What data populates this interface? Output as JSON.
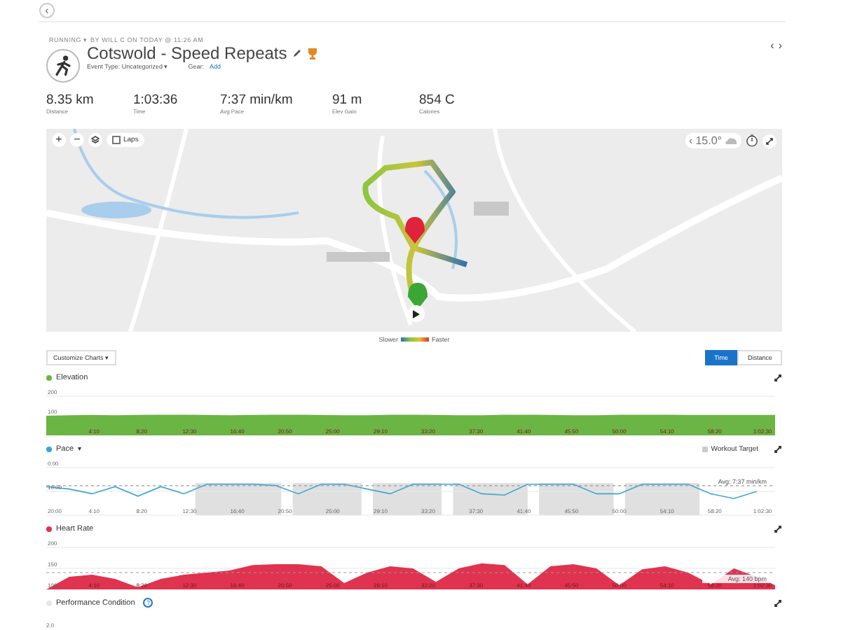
{
  "nav": {
    "back": "‹",
    "prev": "‹",
    "next": "›"
  },
  "activity": {
    "breadcrumb": "RUNNING ▾  BY WILL C ON TODAY @ 11:26 AM",
    "title": "Cotswold - Speed Repeats",
    "event_type": "Event Type: Uncategorized ▾",
    "gear_label": "Gear:",
    "gear_link": "Add"
  },
  "stats": [
    {
      "value": "8.35 km",
      "label": "Distance"
    },
    {
      "value": "1:03:36",
      "label": "Time"
    },
    {
      "value": "7:37 min/km",
      "label": "Avg Pace"
    },
    {
      "value": "91 m",
      "label": "Elev Gain"
    },
    {
      "value": "854 C",
      "label": "Calories"
    }
  ],
  "map": {
    "kind": "picture",
    "zoom_in": "+",
    "zoom_out": "−",
    "laps": {
      "label": "Laps",
      "checked": false
    },
    "weather_prev": "‹",
    "temperature": "15.0°"
  },
  "legend": {
    "slower": "Slower",
    "faster": "Faster"
  },
  "customize": "Customize Charts ▾",
  "view_toggle": [
    {
      "label": "Time",
      "selected": true
    },
    {
      "label": "Distance",
      "selected": false
    }
  ],
  "charts": [
    {
      "color": "#6bb544",
      "chart_data": {
        "type": "area",
        "title": "Elevation",
        "x": [
          0,
          2,
          4,
          6,
          8,
          10,
          12,
          14,
          16,
          18,
          20,
          22,
          24,
          26,
          28,
          30,
          32,
          34,
          36,
          38,
          40,
          42,
          44,
          46,
          48,
          50,
          52,
          54,
          56,
          58,
          60,
          62,
          63.6
        ],
        "xlim": [
          0,
          63.6
        ],
        "ylim": [
          0,
          200
        ],
        "yticks": [
          100,
          200
        ],
        "xticks": [
          {
            "value": 4.17,
            "label": "4:10"
          },
          {
            "value": 8.33,
            "label": "8:20"
          },
          {
            "value": 12.5,
            "label": "12:30"
          },
          {
            "value": 16.67,
            "label": "16:40"
          },
          {
            "value": 20.83,
            "label": "20:50"
          },
          {
            "value": 25,
            "label": "25:00"
          },
          {
            "value": 29.17,
            "label": "29:10"
          },
          {
            "value": 33.33,
            "label": "33:20"
          },
          {
            "value": 37.5,
            "label": "37:30"
          },
          {
            "value": 41.67,
            "label": "41:40"
          },
          {
            "value": 45.83,
            "label": "45:50"
          },
          {
            "value": 50,
            "label": "50:00"
          },
          {
            "value": 54.17,
            "label": "54:10"
          },
          {
            "value": 58.33,
            "label": "58:20"
          },
          {
            "value": 62.5,
            "label": "1:02:30"
          }
        ],
        "series": [
          {
            "color": "#6bb544",
            "values": [
              100,
              103,
              104,
              103,
              104,
              106,
              105,
              104,
              103,
              104,
              106,
              105,
              104,
              103,
              103,
              106,
              105,
              104,
              103,
              103,
              105,
              106,
              104,
              103,
              103,
              105,
              106,
              105,
              104,
              104,
              104,
              104,
              104
            ]
          }
        ]
      }
    },
    {
      "color": "#3aa6d8",
      "menu": "▾",
      "target_legend": "Workout Target",
      "average_label": "Avg: 7:37 min/km",
      "chart_data": {
        "type": "line",
        "title": "Pace",
        "x": [
          0,
          2,
          4,
          6,
          8,
          10,
          12,
          14,
          16,
          18,
          20,
          22,
          24,
          26,
          28,
          30,
          32,
          34,
          36,
          38,
          40,
          42,
          44,
          46,
          48,
          50,
          52,
          54,
          56,
          58,
          60,
          62
        ],
        "xlim": [
          0,
          63.6
        ],
        "ylim": [
          20,
          0
        ],
        "yticks": [
          {
            "value": 0,
            "label": "0:00"
          },
          {
            "value": 10,
            "label": "10:00"
          },
          {
            "value": 20,
            "label": "20:00"
          }
        ],
        "xticks": [
          {
            "value": 4.17,
            "label": "4:10"
          },
          {
            "value": 8.33,
            "label": "8:20"
          },
          {
            "value": 12.5,
            "label": "12:30"
          },
          {
            "value": 16.67,
            "label": "16:40"
          },
          {
            "value": 20.83,
            "label": "20:50"
          },
          {
            "value": 25,
            "label": "25:00"
          },
          {
            "value": 29.17,
            "label": "29:10"
          },
          {
            "value": 33.33,
            "label": "33:20"
          },
          {
            "value": 37.5,
            "label": "37:30"
          },
          {
            "value": 41.67,
            "label": "41:40"
          },
          {
            "value": 45.83,
            "label": "45:50"
          },
          {
            "value": 50,
            "label": "50:00"
          },
          {
            "value": 54.17,
            "label": "54:10"
          },
          {
            "value": 58.33,
            "label": "58:20"
          },
          {
            "value": 62.5,
            "label": "1:02:30"
          }
        ],
        "series": [
          {
            "color": "#3aa6d8",
            "values": [
              8,
              9,
              11,
              8,
              12,
              8,
              11,
              7,
              7,
              7,
              7.5,
              11,
              7,
              7,
              9,
              11,
              7,
              7,
              7,
              11,
              11.5,
              7,
              7,
              7,
              11,
              11,
              7,
              7,
              7,
              11,
              13,
              10
            ]
          }
        ]
      }
    },
    {
      "color": "#e0334f",
      "average_label": "Avg: 140 bpm",
      "chart_data": {
        "type": "area",
        "title": "Heart Rate",
        "x": [
          0,
          2,
          4,
          6,
          8,
          10,
          12,
          14,
          16,
          18,
          20,
          22,
          24,
          26,
          28,
          30,
          32,
          34,
          36,
          38,
          40,
          42,
          44,
          46,
          48,
          50,
          52,
          54,
          56,
          58,
          60,
          62,
          63.6
        ],
        "xlim": [
          0,
          63.6
        ],
        "ylim": [
          100,
          200
        ],
        "yticks": [
          100,
          150,
          200
        ],
        "xticks": [
          {
            "value": 4.17,
            "label": "4:10"
          },
          {
            "value": 8.33,
            "label": "8:20"
          },
          {
            "value": 12.5,
            "label": "12:30"
          },
          {
            "value": 16.67,
            "label": "16:40"
          },
          {
            "value": 20.83,
            "label": "20:50"
          },
          {
            "value": 25,
            "label": "25:00"
          },
          {
            "value": 29.17,
            "label": "29:10"
          },
          {
            "value": 33.33,
            "label": "33:20"
          },
          {
            "value": 37.5,
            "label": "37:30"
          },
          {
            "value": 41.67,
            "label": "41:40"
          },
          {
            "value": 45.83,
            "label": "45:50"
          },
          {
            "value": 50,
            "label": "50:00"
          },
          {
            "value": 54.17,
            "label": "54:10"
          },
          {
            "value": 58.33,
            "label": "58:20"
          },
          {
            "value": 62.5,
            "label": "1:02:30"
          }
        ],
        "series": [
          {
            "color": "#e0334f",
            "values": [
              100,
              130,
              135,
              125,
              105,
              125,
              135,
              140,
              145,
              158,
              160,
              160,
              155,
              115,
              140,
              155,
              150,
              118,
              150,
              162,
              158,
              112,
              155,
              160,
              150,
              110,
              148,
              155,
              140,
              112,
              150,
              130,
              110
            ]
          }
        ]
      }
    },
    {
      "title": "Performance Condition",
      "color": "#e6e6e6",
      "help": "?",
      "axis_label": "2.0"
    }
  ]
}
